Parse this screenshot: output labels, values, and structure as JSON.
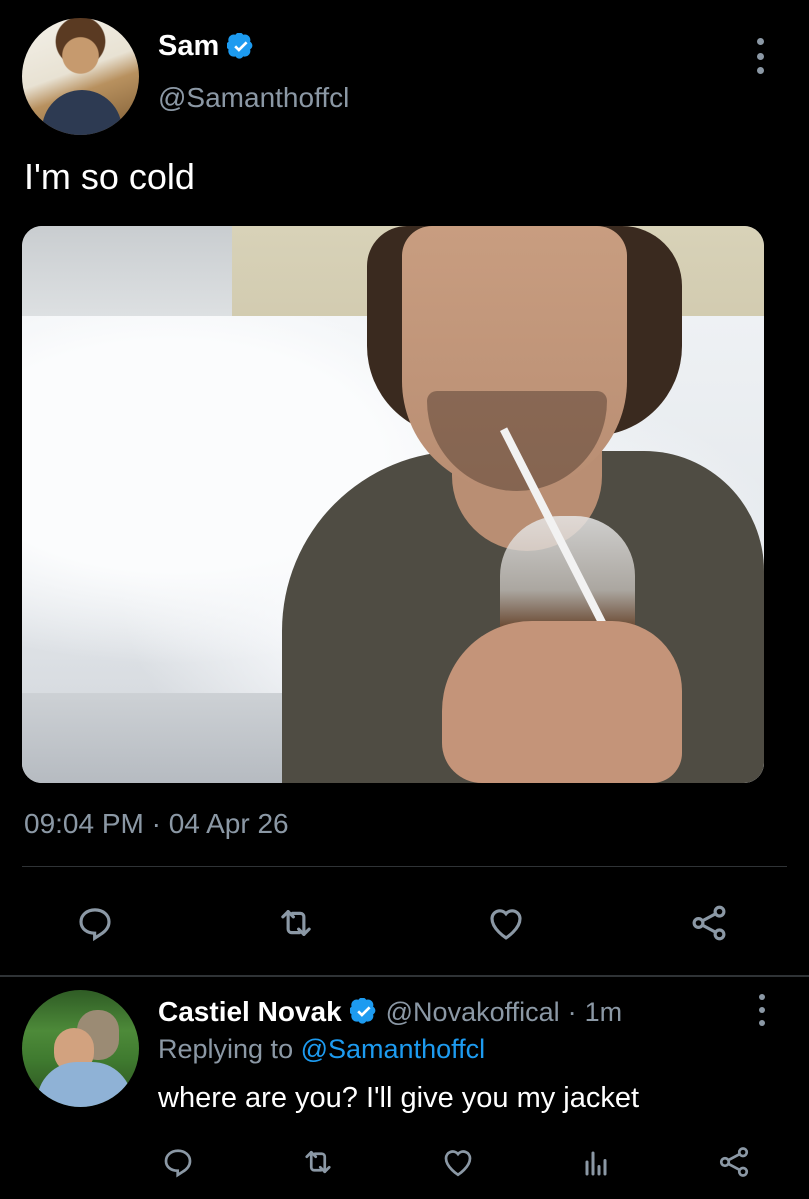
{
  "tweet": {
    "author": {
      "display_name": "Sam",
      "handle": "@Samanthoffcl",
      "verified": true,
      "avatar": "avatar-photo"
    },
    "text": "I'm so cold",
    "image": "selfie-photo-snow",
    "timestamp": "09:04 PM · 04 Apr 26",
    "actions": [
      "reply-icon",
      "retweet-icon",
      "like-icon",
      "share-icon"
    ],
    "more_icon": "more-vertical-icon"
  },
  "reply": {
    "author": {
      "display_name": "Castiel Novak",
      "handle": "@Novakoffical",
      "verified": true,
      "avatar": "avatar-photo"
    },
    "separator": "·",
    "time": "1m",
    "replying_prefix": "Replying to",
    "replying_to": "@Samanthoffcl",
    "text": "where are you? I'll give you my jacket",
    "actions": [
      "reply-icon",
      "retweet-icon",
      "like-icon",
      "analytics-icon",
      "share-icon"
    ],
    "more_icon": "more-vertical-icon"
  },
  "colors": {
    "background": "#000000",
    "text_primary": "#ffffff",
    "text_secondary": "#8b98a5",
    "accent": "#1d9bf0",
    "divider": "#2f3336"
  }
}
